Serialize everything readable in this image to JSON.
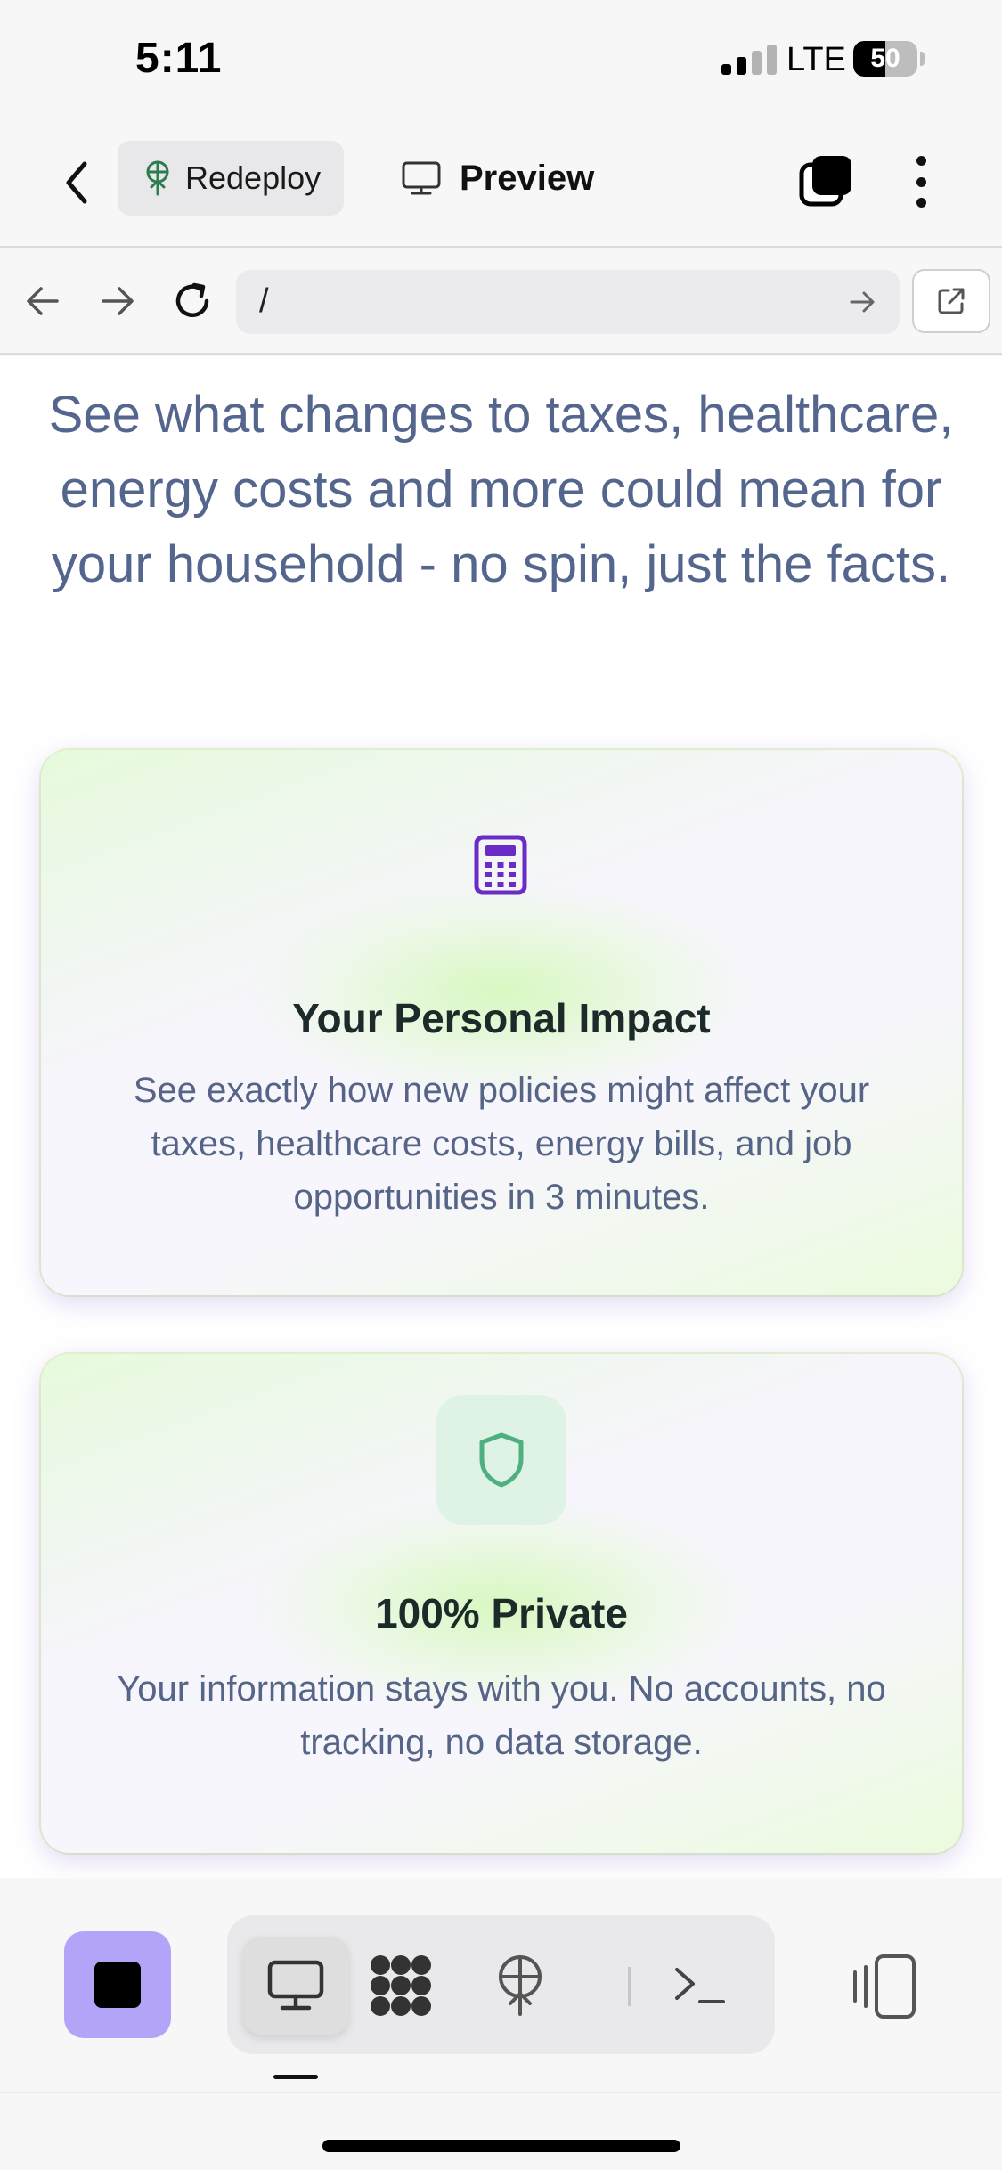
{
  "status_bar": {
    "time": "5:11",
    "network": "LTE",
    "battery": "50",
    "battery_level": 0.5
  },
  "header": {
    "back_icon": "chevron-left-icon",
    "redeploy_label": "Redeploy",
    "preview_label": "Preview"
  },
  "url_bar": {
    "url": "/"
  },
  "page": {
    "lead": "See what changes to taxes, healthcare, energy costs and more could mean for your household - no spin, just the facts.",
    "cards": [
      {
        "icon": "calculator-icon",
        "title": "Your Personal Impact",
        "description": "See exactly how new policies might affect your taxes, healthcare costs, energy bills, and job opportunities in 3 minutes."
      },
      {
        "icon": "shield-icon",
        "title": "100% Private",
        "description": "Your information stays with you. No accounts, no tracking, no data storage."
      }
    ]
  },
  "colors": {
    "accent_purple": "#b4a4f7",
    "calculator": "#6a2cc4",
    "shield": "#4fb07f",
    "lead_text": "#54658e"
  },
  "toolbar": {
    "items": [
      "stop-icon",
      "monitor-icon",
      "grid-icon",
      "deploy-icon",
      "terminal-icon",
      "device-toggle-icon"
    ]
  }
}
